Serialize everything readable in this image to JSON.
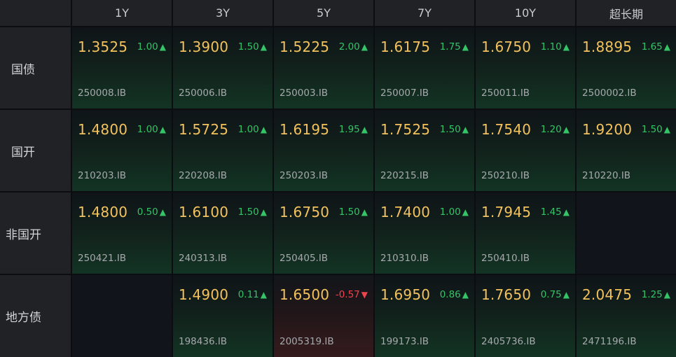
{
  "colors": {
    "yield": "#f3c25d",
    "up": "#35c467",
    "down": "#f0444d",
    "code": "#a6a9ad"
  },
  "icons": {
    "up": "triangle-up-icon",
    "down": "triangle-down-icon"
  },
  "columns": [
    "1Y",
    "3Y",
    "5Y",
    "7Y",
    "10Y",
    "超长期"
  ],
  "rows": [
    {
      "label": "国债",
      "cells": [
        {
          "yield": "1.3525",
          "change": "1.00",
          "arrow": "▲",
          "dir": "up",
          "code": "250008.IB"
        },
        {
          "yield": "1.3900",
          "change": "1.50",
          "arrow": "▲",
          "dir": "up",
          "code": "250006.IB"
        },
        {
          "yield": "1.5225",
          "change": "2.00",
          "arrow": "▲",
          "dir": "up",
          "code": "250003.IB"
        },
        {
          "yield": "1.6175",
          "change": "1.75",
          "arrow": "▲",
          "dir": "up",
          "code": "250007.IB"
        },
        {
          "yield": "1.6750",
          "change": "1.10",
          "arrow": "▲",
          "dir": "up",
          "code": "250011.IB"
        },
        {
          "yield": "1.8895",
          "change": "1.65",
          "arrow": "▲",
          "dir": "up",
          "code": "2500002.IB"
        }
      ]
    },
    {
      "label": "国开",
      "cells": [
        {
          "yield": "1.4800",
          "change": "1.00",
          "arrow": "▲",
          "dir": "up",
          "code": "210203.IB"
        },
        {
          "yield": "1.5725",
          "change": "1.00",
          "arrow": "▲",
          "dir": "up",
          "code": "220208.IB"
        },
        {
          "yield": "1.6195",
          "change": "1.95",
          "arrow": "▲",
          "dir": "up",
          "code": "250203.IB"
        },
        {
          "yield": "1.7525",
          "change": "1.50",
          "arrow": "▲",
          "dir": "up",
          "code": "220215.IB"
        },
        {
          "yield": "1.7540",
          "change": "1.20",
          "arrow": "▲",
          "dir": "up",
          "code": "250210.IB"
        },
        {
          "yield": "1.9200",
          "change": "1.50",
          "arrow": "▲",
          "dir": "up",
          "code": "210220.IB"
        }
      ]
    },
    {
      "label": "非国开",
      "cells": [
        {
          "yield": "1.4800",
          "change": "0.50",
          "arrow": "▲",
          "dir": "up",
          "code": "250421.IB"
        },
        {
          "yield": "1.6100",
          "change": "1.50",
          "arrow": "▲",
          "dir": "up",
          "code": "240313.IB"
        },
        {
          "yield": "1.6750",
          "change": "1.50",
          "arrow": "▲",
          "dir": "up",
          "code": "250405.IB"
        },
        {
          "yield": "1.7400",
          "change": "1.00",
          "arrow": "▲",
          "dir": "up",
          "code": "210310.IB"
        },
        {
          "yield": "1.7945",
          "change": "1.45",
          "arrow": "▲",
          "dir": "up",
          "code": "250410.IB"
        },
        null
      ]
    },
    {
      "label": "地方债",
      "cells": [
        null,
        {
          "yield": "1.4900",
          "change": "0.11",
          "arrow": "▲",
          "dir": "up",
          "code": "198436.IB"
        },
        {
          "yield": "1.6500",
          "change": "-0.57",
          "arrow": "▼",
          "dir": "down",
          "code": "2005319.IB"
        },
        {
          "yield": "1.6950",
          "change": "0.86",
          "arrow": "▲",
          "dir": "up",
          "code": "199173.IB"
        },
        {
          "yield": "1.7650",
          "change": "0.75",
          "arrow": "▲",
          "dir": "up",
          "code": "2405736.IB"
        },
        {
          "yield": "2.0475",
          "change": "1.25",
          "arrow": "▲",
          "dir": "up",
          "code": "2471196.IB"
        }
      ]
    }
  ]
}
